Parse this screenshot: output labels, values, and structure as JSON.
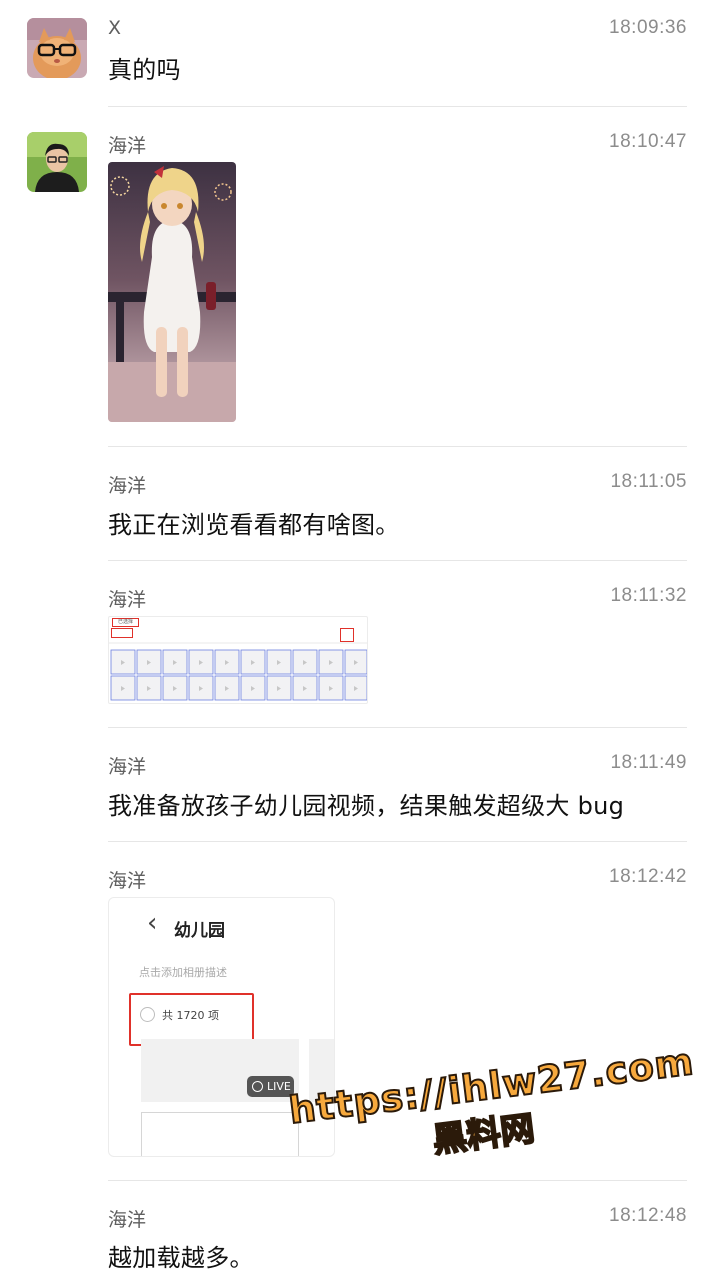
{
  "messages": [
    {
      "sender": "X",
      "time": "18:09:36",
      "text": "真的吗",
      "avatar": "cat-with-glasses-avatar"
    },
    {
      "sender": "海洋",
      "time": "18:10:47",
      "image": "anime-girl-image",
      "avatar": "man-avatar"
    },
    {
      "sender": "海洋",
      "time": "18:11:05",
      "text": "我正在浏览看看都有啥图。"
    },
    {
      "sender": "海洋",
      "time": "18:11:32",
      "image": "video-grid-screenshot"
    },
    {
      "sender": "海洋",
      "time": "18:11:49",
      "text": "我准备放孩子幼儿园视频，结果触发超级大 bug"
    },
    {
      "sender": "海洋",
      "time": "18:12:42",
      "image": "album-screenshot"
    },
    {
      "sender": "海洋",
      "time": "18:12:48",
      "text": "越加载越多。"
    }
  ],
  "album": {
    "back_icon": "‹",
    "title": "幼儿园",
    "description_placeholder": "点击添加相册描述",
    "count_label": "共 1720 项",
    "live_badge": "LIVE"
  },
  "grid_shot": {
    "tab_label": "已选择"
  },
  "watermark": {
    "url": "https://ihlw27.com",
    "name": "黑料网"
  },
  "colors": {
    "highlight_red": "#e0312a",
    "watermark_fill": "#f7a93d",
    "grid_blue": "#6b7fe0"
  }
}
